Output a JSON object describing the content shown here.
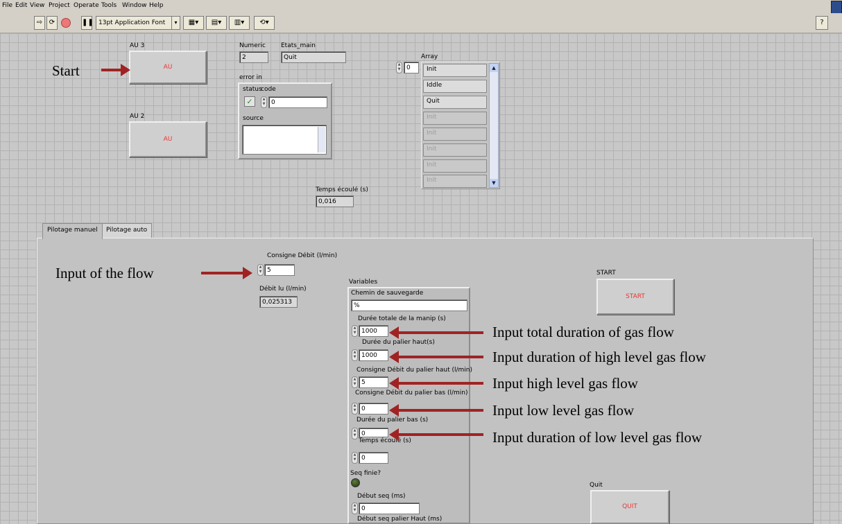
{
  "menu": [
    "File",
    "Edit",
    "View",
    "Project",
    "Operate",
    "Tools",
    "Window",
    "Help"
  ],
  "toolbar": {
    "font_select": "13pt Application Font"
  },
  "controls": {
    "au3": {
      "label": "AU 3",
      "button": "AU"
    },
    "au2": {
      "label": "AU 2",
      "button": "AU"
    },
    "numeric": {
      "label": "Numeric",
      "value": "2"
    },
    "etats_main": {
      "label": "Etats_main",
      "value": "Quit"
    },
    "error_in": {
      "label": "error in",
      "status_label": "status",
      "code_label": "code",
      "code_value": "0",
      "source_label": "source"
    },
    "array": {
      "label": "Array",
      "index": "0",
      "items": [
        "Init",
        "Iddle",
        "Quit",
        "Init",
        "Init",
        "Init",
        "Init",
        "Init"
      ]
    },
    "temps_ecoule": {
      "label": "Temps écoulé (s)",
      "value": "0,016"
    }
  },
  "tabs": [
    "Pilotage manuel",
    "Pilotage auto"
  ],
  "manual": {
    "consigne_debit": {
      "label": "Consigne Débit (l/min)",
      "value": "5"
    },
    "debit_lu": {
      "label": "Débit lu (l/min)",
      "value": "0,025313"
    },
    "variables": {
      "label": "Variables",
      "chemin_label": "Chemin de sauvegarde",
      "chemin_value": "%",
      "duree_totale": {
        "label": "Durée totale de la manip (s)",
        "value": "1000"
      },
      "duree_palier_haut": {
        "label": "Durée du palier haut(s)",
        "value": "1000"
      },
      "consigne_palier_haut": {
        "label": "Consigne Débit du palier haut (l/min)",
        "value": "5"
      },
      "consigne_palier_bas": {
        "label": "Consigne Débit du palier bas (l/min)",
        "value": "0"
      },
      "duree_palier_bas": {
        "label": "Durée du palier bas (s)",
        "value": "0"
      },
      "temps_ecoule": {
        "label": "Temps écoulé (s)",
        "value": "0"
      },
      "seq_finie": {
        "label": "Seq finie?"
      },
      "debut_seq": {
        "label": "Début seq (ms)",
        "value": "0"
      },
      "debut_seq_palier_haut": {
        "label": "Début seq palier Haut (ms)"
      }
    },
    "start": {
      "label": "START",
      "button": "START"
    },
    "quit": {
      "label": "Quit",
      "button": "QUIT"
    }
  },
  "annotations": {
    "start": "Start",
    "flow": "Input of  the flow",
    "total": "Input total duration of gas flow",
    "high_duration": "Input duration of high level gas flow",
    "high_flow": "Input high level gas flow",
    "low_flow": "Input low level gas flow",
    "low_duration": "Input duration of low level gas flow"
  },
  "colors": {
    "arrow": "#a02323",
    "button_text": "#e33333"
  }
}
